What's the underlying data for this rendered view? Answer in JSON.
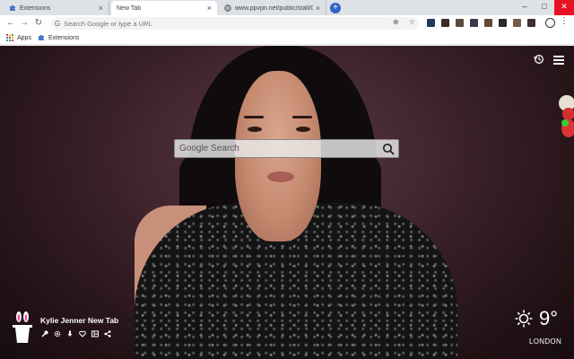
{
  "tabs": [
    {
      "label": "Extensions",
      "close": "×"
    },
    {
      "label": "New Tab",
      "close": "×"
    },
    {
      "label": "www.ppvpn.net/public/stall/G",
      "close": "×"
    }
  ],
  "new_tab_symbol": "+",
  "window_controls": {
    "minimize": "–",
    "maximize": "□",
    "close": "✕"
  },
  "omnibox": {
    "placeholder": "Search Google or type a URL",
    "value": ""
  },
  "bookmarks": [
    {
      "label": "Apps"
    },
    {
      "label": "Extensions"
    }
  ],
  "page": {
    "search_placeholder": "Google Search",
    "extension_name": "Kylie Jenner New Tab",
    "temperature": "9°",
    "city": "LONDON"
  },
  "colors": {
    "accent": "#2f63c8",
    "close_red": "#e81123",
    "tabstrip": "#dee1e6"
  },
  "icons": {
    "tools": [
      "wrench-icon",
      "gear-icon",
      "download-icon",
      "heart-icon",
      "layout-icon",
      "share-icon"
    ],
    "toolbar": [
      "back-icon",
      "forward-icon",
      "reload-icon",
      "bookmark-star-icon",
      "profile-icon",
      "menu-icon"
    ],
    "weather": "sun-icon"
  }
}
